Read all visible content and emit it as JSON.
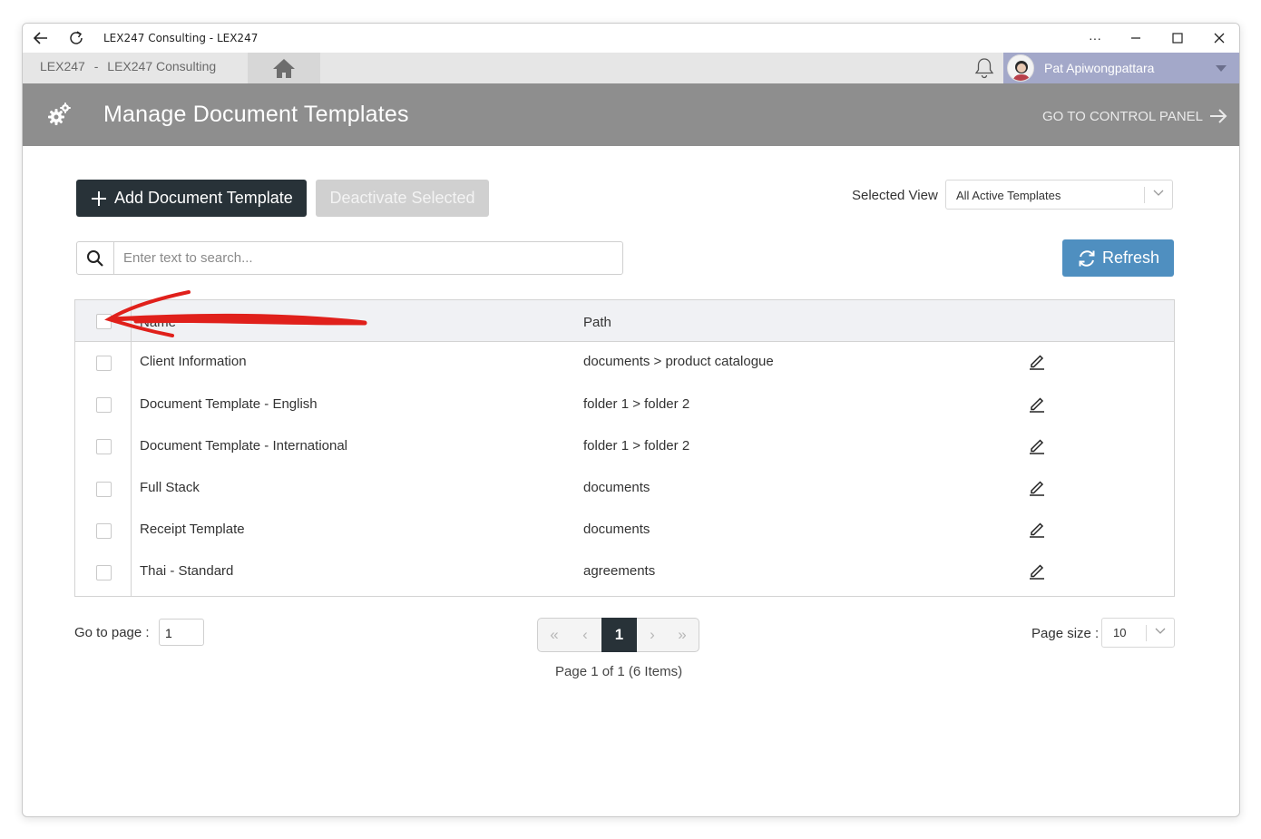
{
  "window": {
    "title": "LEX247 Consulting - LEX247",
    "controls": [
      "more-icon",
      "minimize-icon",
      "maximize-icon",
      "close-icon"
    ]
  },
  "tabbar": {
    "tab_org": "LEX247",
    "tab_sep": "-",
    "tab_company": "LEX247 Consulting",
    "user_name": "Pat Apiwongpattara"
  },
  "header": {
    "title": "Manage Document Templates",
    "control_panel_link": "GO TO CONTROL PANEL"
  },
  "toolbar": {
    "add_label": "Add Document Template",
    "deactivate_label": "Deactivate Selected",
    "view_label": "Selected View",
    "view_value": "All Active Templates",
    "search_placeholder": "Enter text to search...",
    "refresh_label": "Refresh"
  },
  "table": {
    "columns": [
      "Name",
      "Path"
    ],
    "rows": [
      {
        "name": "Client Information",
        "path": "documents > product catalogue"
      },
      {
        "name": "Document Template - English",
        "path": "folder 1 > folder 2"
      },
      {
        "name": "Document Template - International",
        "path": "folder 1 > folder 2"
      },
      {
        "name": "Full Stack",
        "path": "documents"
      },
      {
        "name": "Receipt Template",
        "path": "documents"
      },
      {
        "name": "Thai - Standard",
        "path": "agreements"
      }
    ]
  },
  "pager": {
    "goto_label": "Go to page :",
    "goto_value": "1",
    "current_page": "1",
    "info": "Page 1 of 1 (6 Items)",
    "page_size_label": "Page size :",
    "page_size_value": "10"
  },
  "colors": {
    "header_bg": "#8e8e8e",
    "primary_button": "#283238",
    "refresh_button": "#4f8fc0",
    "user_bar": "#a3a8c9",
    "annotation_arrow": "#e0201b"
  }
}
